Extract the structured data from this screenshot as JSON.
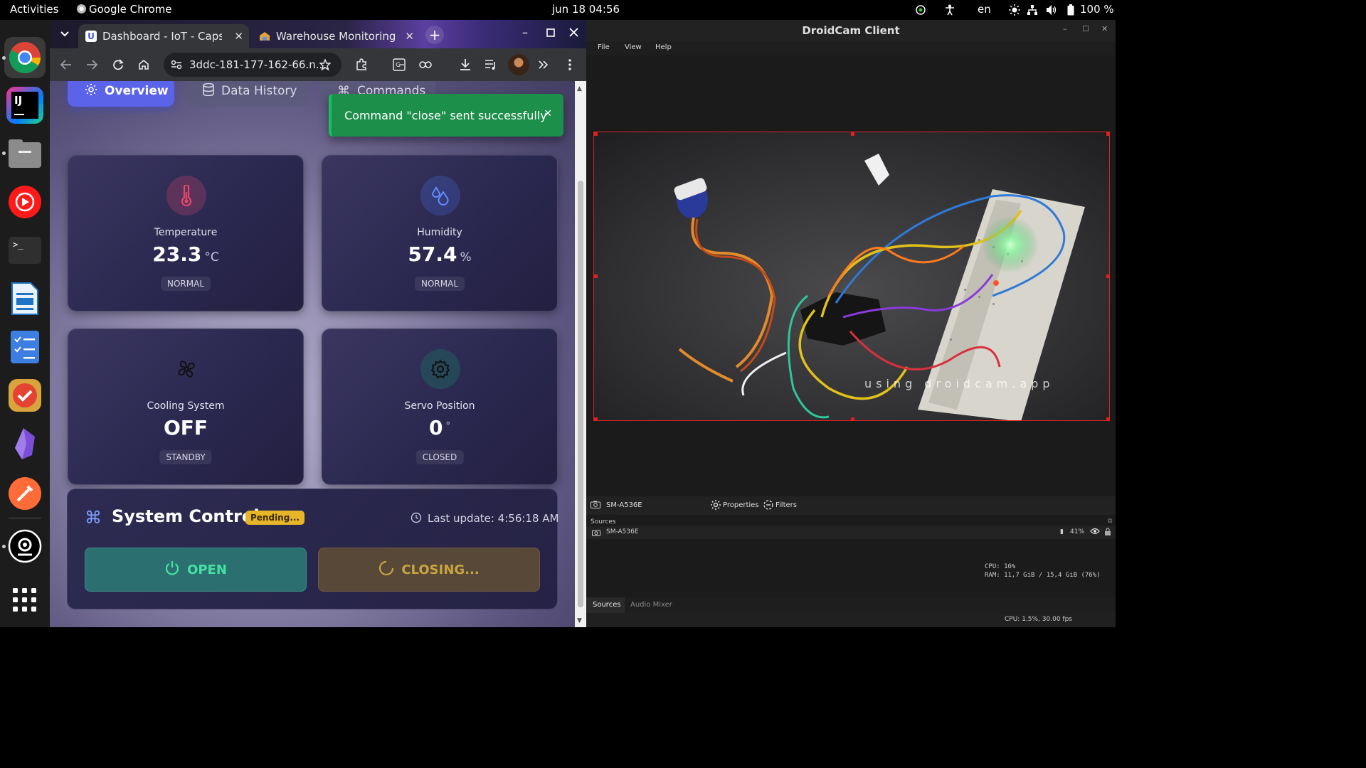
{
  "topbar": {
    "activities": "Activities",
    "app_name": "Google Chrome",
    "datetime": "jun 18  04:56",
    "language": "en",
    "battery": "100 %"
  },
  "chrome": {
    "tabs": [
      {
        "title": "Dashboard - IoT - Capstone",
        "active": true
      },
      {
        "title": "Warehouse Monitoring System",
        "active": false
      }
    ],
    "url": "3ddc-181-177-162-66.n..."
  },
  "dashboard": {
    "nav_tabs": [
      {
        "label": "Overview"
      },
      {
        "label": "Data History"
      },
      {
        "label": "Commands"
      }
    ],
    "toast": "Command \"close\" sent successfully",
    "cards": [
      {
        "label": "Temperature",
        "value": "23.3",
        "unit": "°C",
        "status": "NORMAL",
        "icon": "thermometer-icon",
        "color": "#e5486a"
      },
      {
        "label": "Humidity",
        "value": "57.4",
        "unit": "%",
        "status": "NORMAL",
        "icon": "droplets-icon",
        "color": "#4f7cff"
      },
      {
        "label": "Cooling System",
        "value": "OFF",
        "unit": "",
        "status": "STANDBY",
        "icon": "fan-icon",
        "color": "#111111"
      },
      {
        "label": "Servo Position",
        "value": "0",
        "unit": "°",
        "status": "CLOSED",
        "icon": "gear-icon",
        "color": "#1e1e2a"
      }
    ],
    "control": {
      "title": "System Control",
      "pending": "Pending...",
      "last_update": "Last update: 4:56:18 AM",
      "open_label": "OPEN",
      "closing_label": "CLOSING..."
    }
  },
  "droidcam": {
    "title": "DroidCam Client",
    "menu": [
      "File",
      "View",
      "Help"
    ],
    "watermark": "using droidcam.app",
    "device": "SM-A536E",
    "properties": "Properties",
    "filters": "Filters",
    "sources_label": "Sources",
    "source_item": "SM-A536E",
    "volume": "41%",
    "cpu": "CPU: 16%",
    "ram": "RAM: 11,7 GiB / 15,4 GiB (76%)",
    "bottom_tabs": [
      "Sources",
      "Audio Mixer"
    ],
    "status": "CPU: 1.5%, 30.00 fps"
  }
}
